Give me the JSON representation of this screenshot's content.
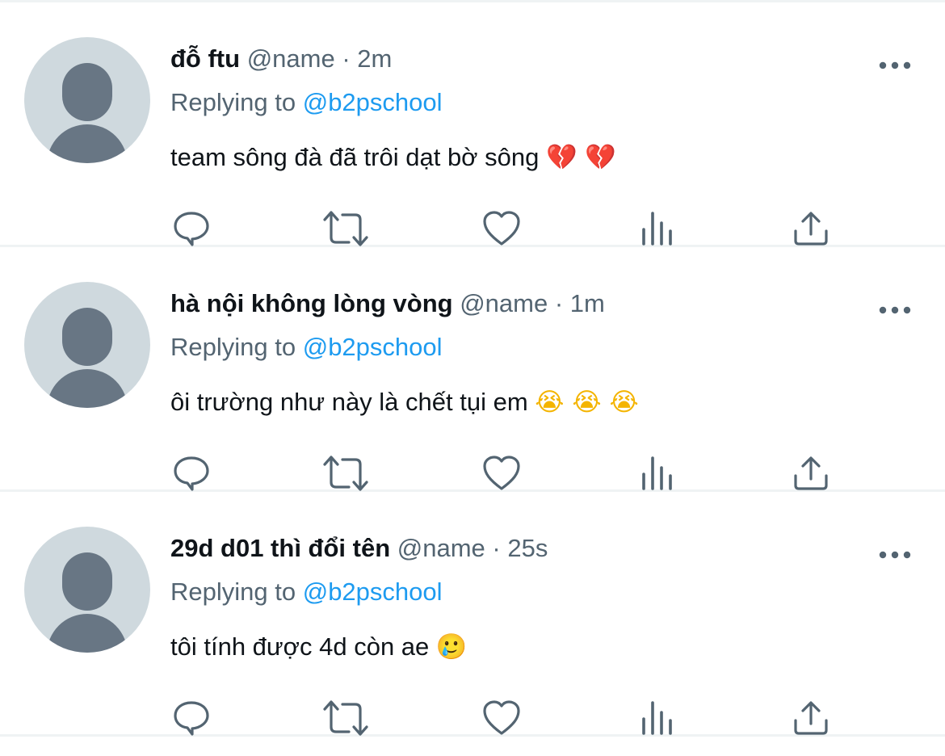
{
  "reply_prefix": "Replying to",
  "icons": {
    "more": "more-horizontal-icon",
    "reply": "reply-icon",
    "retweet": "retweet-icon",
    "like": "heart-icon",
    "views": "views-icon",
    "share": "share-icon"
  },
  "colors": {
    "link": "#1d9bf0",
    "secondary_text": "#536471",
    "icon": "#536471",
    "avatar_bg": "#cfd9de",
    "avatar_fg": "#687684",
    "divider": "#eff3f4"
  },
  "tweets": [
    {
      "display_name": "đỗ ftu",
      "handle": "@name",
      "separator": "·",
      "timestamp": "2m",
      "reply_to": "@b2pschool",
      "text": "team sông đà đã trôi dạt bờ sông",
      "emojis": "💔 💔"
    },
    {
      "display_name": "hà nội không lòng vòng",
      "handle": "@name",
      "separator": "·",
      "timestamp": "1m",
      "reply_to": "@b2pschool",
      "text": "ôi trường như này là chết tụi em",
      "emojis": "😭 😭 😭"
    },
    {
      "display_name": "29d d01 thì đổi tên",
      "handle": "@name",
      "separator": "·",
      "timestamp": "25s",
      "reply_to": "@b2pschool",
      "text": "tôi tính được 4d còn ae",
      "emojis": "🥲"
    }
  ]
}
